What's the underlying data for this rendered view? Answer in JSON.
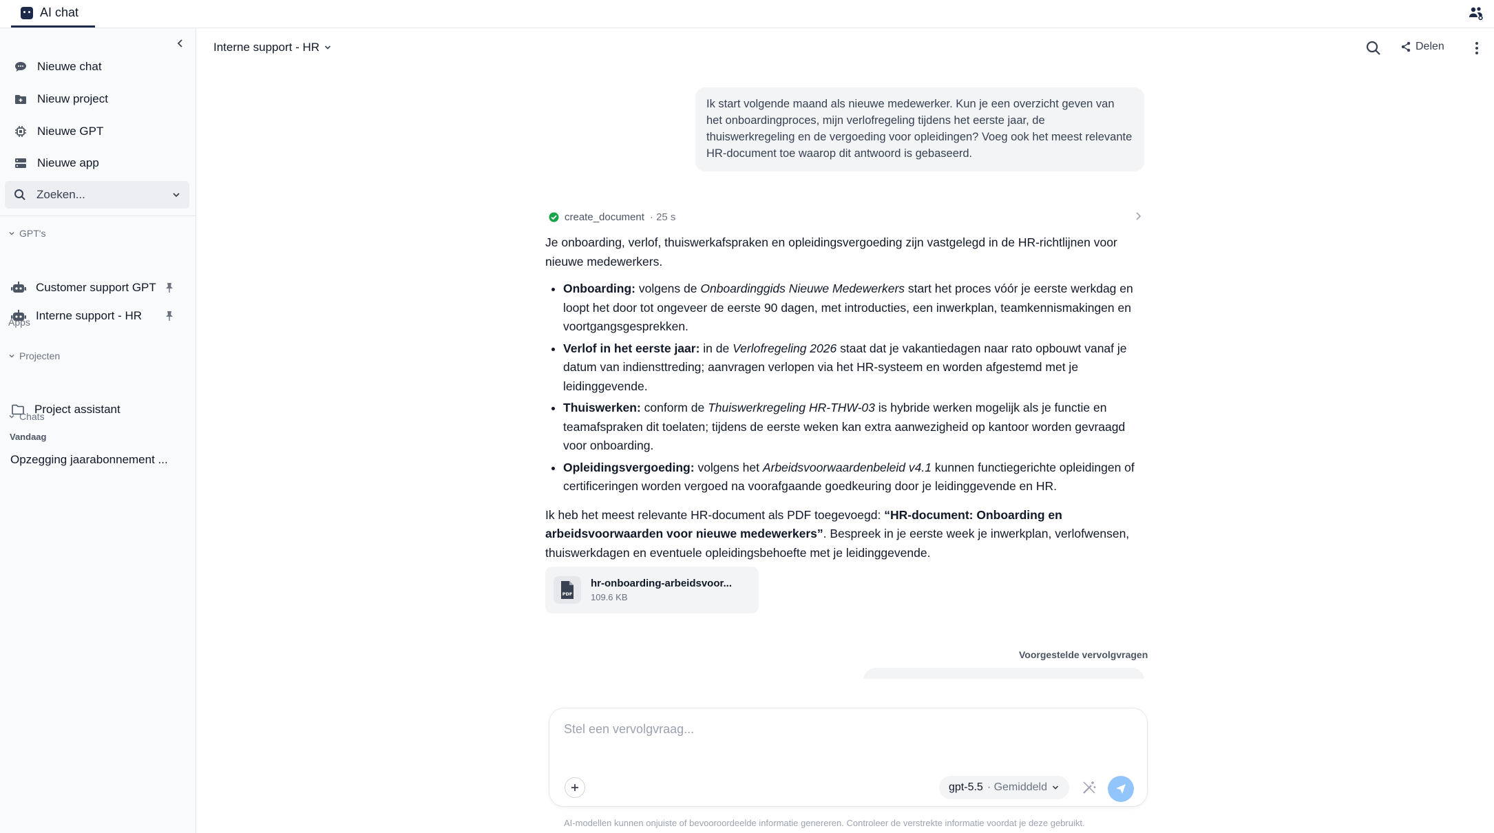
{
  "tab": {
    "label": "AI chat"
  },
  "sidebar": {
    "actions": [
      {
        "label": "Nieuwe chat",
        "icon": "chat-bubble-icon"
      },
      {
        "label": "Nieuw project",
        "icon": "folder-plus-icon"
      },
      {
        "label": "Nieuwe GPT",
        "icon": "cpu-icon"
      },
      {
        "label": "Nieuwe app",
        "icon": "server-icon"
      }
    ],
    "search": {
      "placeholder": "Zoeken..."
    },
    "gpts_label": "GPT's",
    "gpts": [
      {
        "label": "Customer support GPT",
        "pinned": true
      },
      {
        "label": "Interne support - HR",
        "pinned": true
      }
    ],
    "apps_label": "Apps",
    "projects_label": "Projecten",
    "projects": [
      {
        "label": "Project assistant"
      }
    ],
    "chats_label": "Chats",
    "today_label": "Vandaag",
    "chats": [
      {
        "label": "Opzegging jaarabonnement ..."
      }
    ]
  },
  "header": {
    "title": "Interne support - HR",
    "share_label": "Delen"
  },
  "conversation": {
    "user_message": "Ik start volgende maand als nieuwe medewerker. Kun je een overzicht geven van het onboardingproces, mijn verlofregeling tijdens het eerste jaar, de thuiswerkregeling en de vergoeding voor opleidingen? Voeg ook het meest relevante HR-document toe waarop dit antwoord is gebaseerd.",
    "tool": {
      "name": "create_document",
      "duration": "· 25 s",
      "status_color": "#16a34a"
    },
    "intro": "Je onboarding, verlof, thuiswerkafspraken en opleidingsvergoeding zijn vastgelegd in de HR-richtlijnen voor nieuwe medewerkers.",
    "bullets": [
      {
        "head": "Onboarding:",
        "pre": " volgens de ",
        "ref": "Onboardinggids Nieuwe Medewerkers",
        "post": " start het proces vóór je eerste werkdag en loopt het door tot ongeveer de eerste 90 dagen, met introducties, een inwerkplan, teamkennismakingen en voortgangsgesprekken."
      },
      {
        "head": "Verlof in het eerste jaar:",
        "pre": " in de ",
        "ref": "Verlofregeling 2026",
        "post": " staat dat je vakantiedagen naar rato opbouwt vanaf je datum van indiensttreding; aanvragen verlopen via het HR-systeem en worden afgestemd met je leidinggevende."
      },
      {
        "head": "Thuiswerken:",
        "pre": " conform de ",
        "ref": "Thuiswerkregeling HR-THW-03",
        "post": " is hybride werken mogelijk als je functie en teamafspraken dit toelaten; tijdens de eerste weken kan extra aanwezigheid op kantoor worden gevraagd voor onboarding."
      },
      {
        "head": "Opleidingsvergoeding:",
        "pre": " volgens het ",
        "ref": "Arbeidsvoorwaardenbeleid v4.1",
        "post": " kunnen functiegerichte opleidingen of certificeringen worden vergoed na voorafgaande goedkeuring door je leidinggevende en HR."
      }
    ],
    "closing_pre": "Ik heb het meest relevante HR-document als PDF toegevoegd: ",
    "closing_bold": "“HR-document: Onboarding en arbeidsvoorwaarden voor nieuwe medewerkers”",
    "closing_post": ". Bespreek in je eerste week je inwerkplan, verlofwensen, thuiswerkdagen en eventuele opleidingsbehoefte met je leidinggevende.",
    "attachment": {
      "name": "hr-onboarding-arbeidsvoor...",
      "size": "109.6 KB",
      "icon_text": "PDF"
    },
    "suggestions_label": "Voorgestelde vervolgvragen"
  },
  "composer": {
    "placeholder": "Stel een vervolgvraag...",
    "model": "gpt-5.5",
    "model_mode": "· Gemiddeld"
  },
  "disclaimer": "AI-modellen kunnen onjuiste of bevooroordeelde informatie genereren. Controleer de verstrekte informatie voordat je deze gebruikt.",
  "colors": {
    "accent": "#1e2a4a",
    "send": "#93c5fd",
    "success": "#16a34a"
  }
}
